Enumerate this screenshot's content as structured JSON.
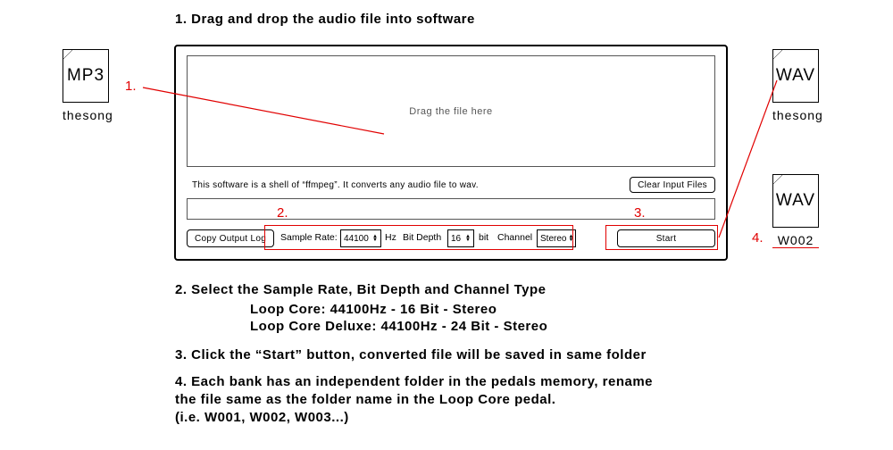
{
  "steps": {
    "s1": "1. Drag and drop the audio file into software",
    "s2": "2. Select the Sample Rate, Bit Depth and Channel Type",
    "s2_sub_a": "Loop Core: 44100Hz - 16 Bit - Stereo",
    "s2_sub_b": "Loop Core Deluxe: 44100Hz - 24 Bit - Stereo",
    "s3": "3. Click the “Start” button, converted file will be saved in same folder",
    "s4a": "4. Each bank has an independent folder in the pedals memory, rename",
    "s4b": "the file same as the folder name in the Loop Core pedal.",
    "s4c": "(i.e. W001, W002, W003...)"
  },
  "annotations": {
    "a1": "1.",
    "a2": "2.",
    "a3": "3.",
    "a4": "4."
  },
  "app": {
    "drop_placeholder": "Drag the file here",
    "info_text": "This software is a shell of “ffmpeg”. It converts any audio file to wav.",
    "clear_btn": "Clear Input Files",
    "copy_btn": "Copy Output Log",
    "start_btn": "Start",
    "sample_rate_label": "Sample Rate:",
    "sample_rate_value": "44100",
    "sample_rate_unit": "Hz",
    "bit_depth_label": "Bit Depth",
    "bit_depth_value": "16",
    "bit_depth_unit": "bit",
    "channel_label": "Channel",
    "channel_value": "Stereo"
  },
  "files": {
    "mp3_ext": "MP3",
    "mp3_name": "thesong",
    "wav_ext": "WAV",
    "wav1_name": "thesong",
    "wav2_name": "W002"
  }
}
